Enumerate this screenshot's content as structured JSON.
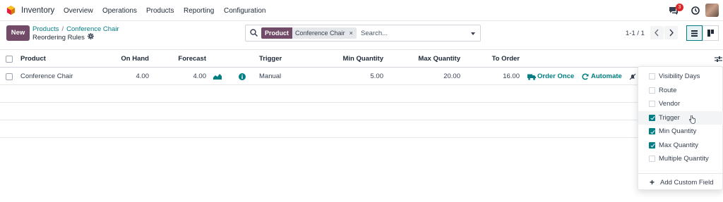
{
  "navbar": {
    "app_name": "Inventory",
    "menu": [
      "Overview",
      "Operations",
      "Products",
      "Reporting",
      "Configuration"
    ],
    "chat_badge": "3",
    "icons": [
      "inventory-logo-icon",
      "chat-icon",
      "clock-icon",
      "user-avatar"
    ]
  },
  "control_panel": {
    "new_label": "New",
    "breadcrumb": [
      "Products",
      "Conference Chair"
    ],
    "breadcrumb_separator": "/",
    "page_title": "Reordering Rules",
    "search": {
      "facet_category": "Product",
      "facet_value": "Conference Chair",
      "facet_remove": "×",
      "placeholder": "Search..."
    },
    "pager": "1-1 / 1"
  },
  "table": {
    "columns": [
      "Product",
      "On Hand",
      "Forecast",
      "Trigger",
      "Min Quantity",
      "Max Quantity",
      "To Order"
    ],
    "rows": [
      {
        "product": "Conference Chair",
        "on_hand": "4.00",
        "forecast": "4.00",
        "trigger": "Manual",
        "min_qty": "5.00",
        "max_qty": "20.00",
        "to_order": "16.00",
        "order_once_label": "Order Once",
        "automate_label": "Automate"
      }
    ]
  },
  "optional_columns": {
    "items": [
      {
        "label": "Visibility Days",
        "checked": false
      },
      {
        "label": "Route",
        "checked": false
      },
      {
        "label": "Vendor",
        "checked": false
      },
      {
        "label": "Trigger",
        "checked": true
      },
      {
        "label": "Min Quantity",
        "checked": true
      },
      {
        "label": "Max Quantity",
        "checked": true
      },
      {
        "label": "Multiple Quantity",
        "checked": false
      }
    ],
    "add_custom_field_label": "Add Custom Field"
  },
  "colors": {
    "brand": "#714b67",
    "accent": "#017e84",
    "badge": "#dc2626"
  }
}
